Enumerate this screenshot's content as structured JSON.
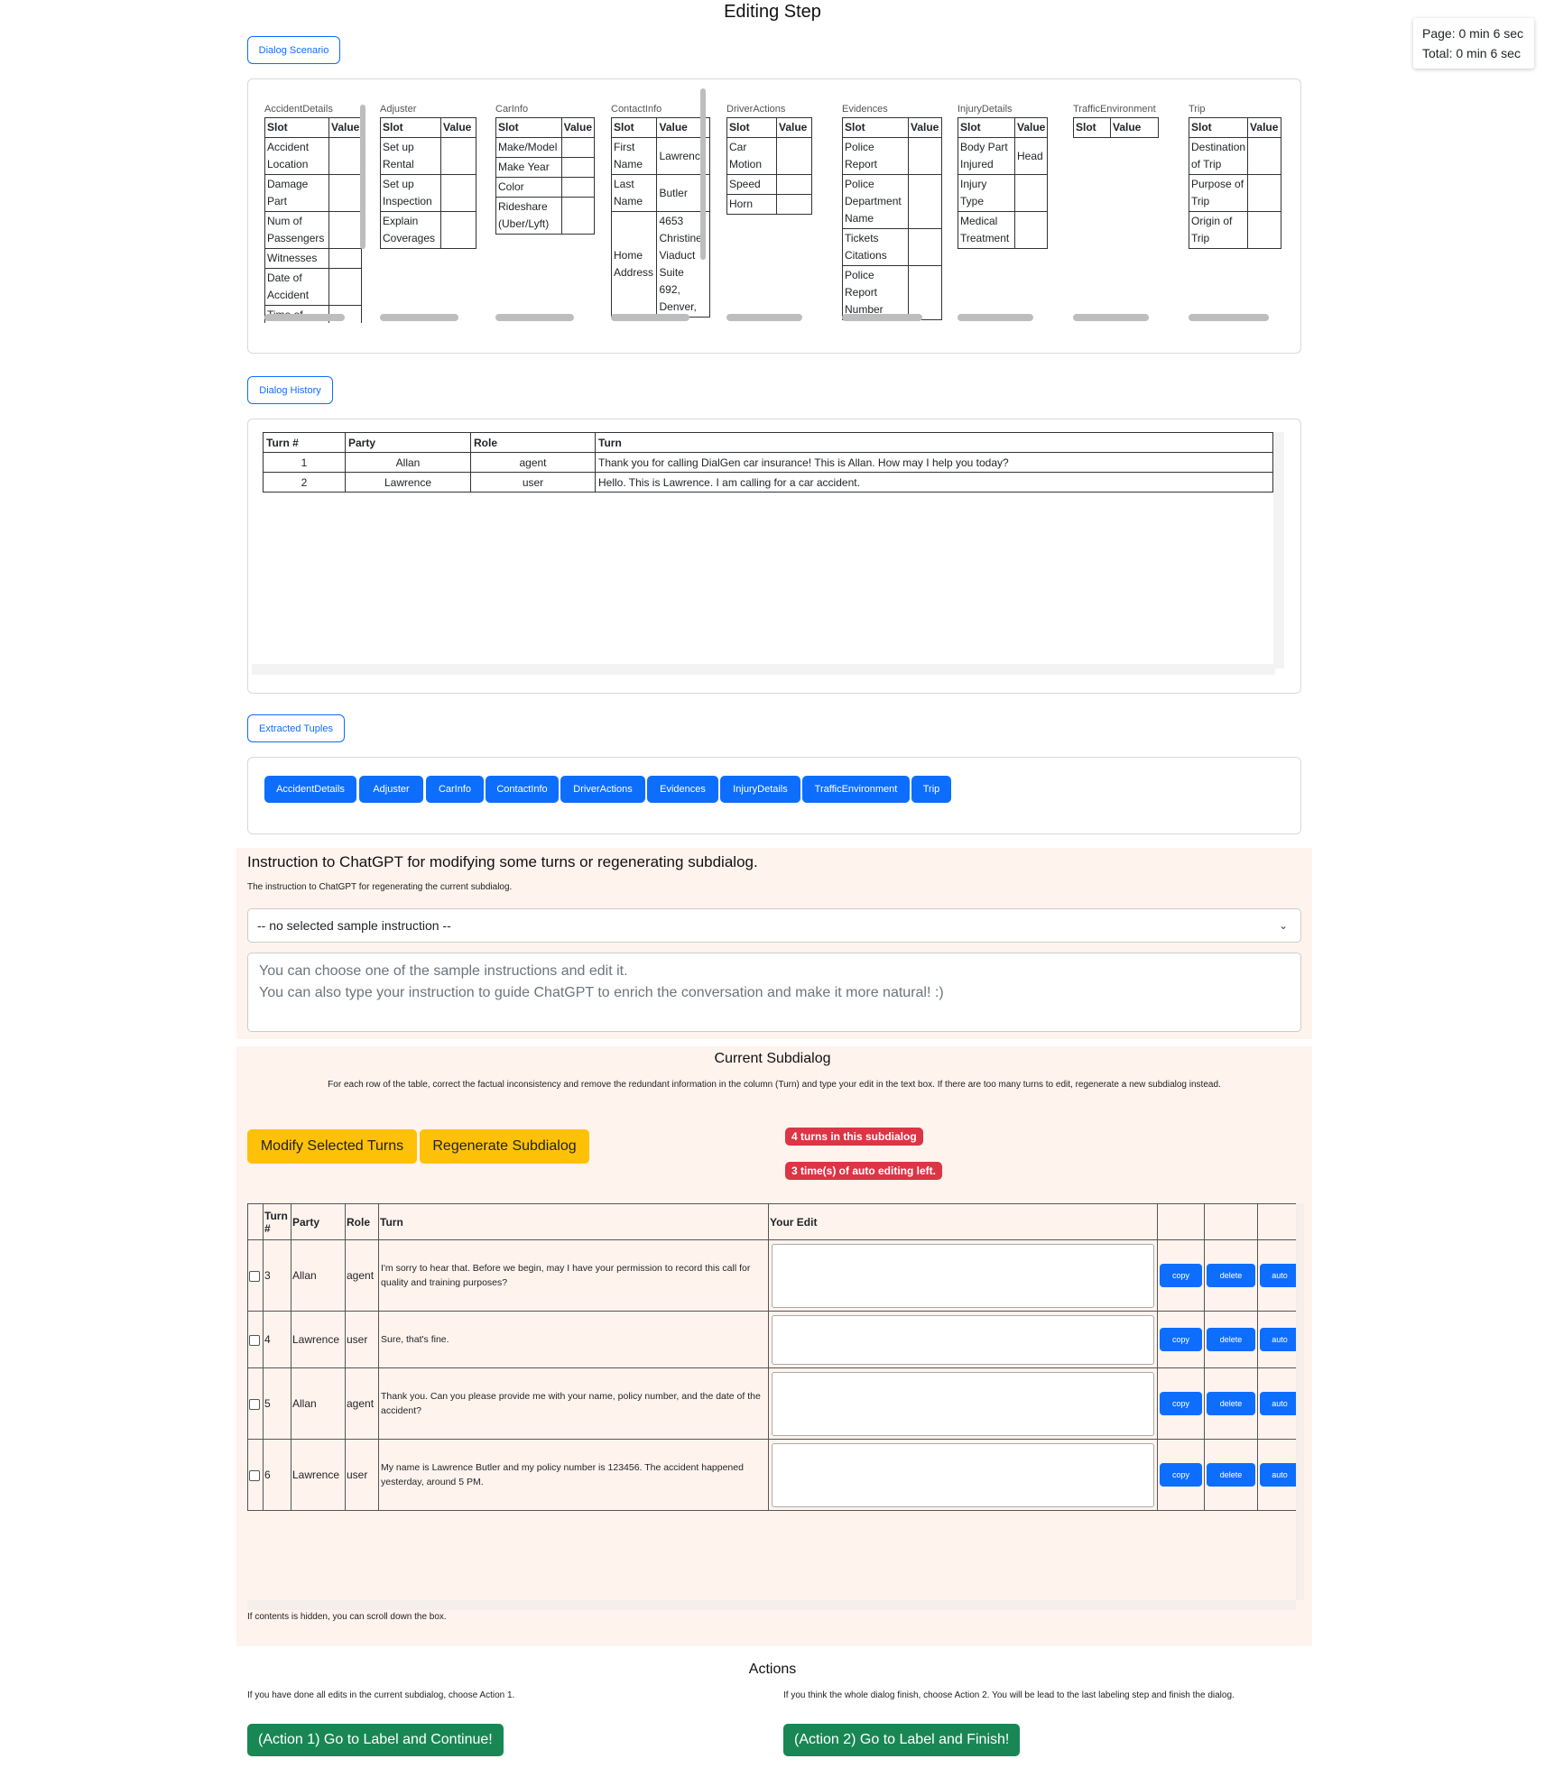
{
  "page_title": "Editing Step",
  "timer": {
    "page": "Page: 0 min 6 sec",
    "total": "Total: 0 min 6 sec"
  },
  "scenario": {
    "button": "Dialog Scenario",
    "slot_header": "Slot",
    "value_header": "Value",
    "categories": [
      {
        "name": "AccidentDetails",
        "rows": [
          {
            "slot": "Accident Location",
            "value": ""
          },
          {
            "slot": "Damage Part",
            "value": ""
          },
          {
            "slot": "Num of Passengers",
            "value": ""
          },
          {
            "slot": "Witnesses",
            "value": ""
          },
          {
            "slot": "Date of Accident",
            "value": ""
          },
          {
            "slot": "Time of",
            "value": ""
          }
        ]
      },
      {
        "name": "Adjuster",
        "rows": [
          {
            "slot": "Set up Rental",
            "value": ""
          },
          {
            "slot": "Set up Inspection",
            "value": ""
          },
          {
            "slot": "Explain Coverages",
            "value": ""
          }
        ]
      },
      {
        "name": "CarInfo",
        "rows": [
          {
            "slot": "Make/Model",
            "value": ""
          },
          {
            "slot": "Make Year",
            "value": ""
          },
          {
            "slot": "Color",
            "value": ""
          },
          {
            "slot": "Rideshare (Uber/Lyft)",
            "value": ""
          }
        ]
      },
      {
        "name": "ContactInfo",
        "rows": [
          {
            "slot": "First Name",
            "value": "Lawrence"
          },
          {
            "slot": "Last Name",
            "value": "Butler"
          },
          {
            "slot": "Home Address",
            "value": "4653 Christine Viaduct Suite 692, Denver,"
          }
        ]
      },
      {
        "name": "DriverActions",
        "rows": [
          {
            "slot": "Car Motion",
            "value": ""
          },
          {
            "slot": "Speed",
            "value": ""
          },
          {
            "slot": "Horn",
            "value": ""
          }
        ]
      },
      {
        "name": "Evidences",
        "rows": [
          {
            "slot": "Police Report",
            "value": ""
          },
          {
            "slot": "Police Department Name",
            "value": ""
          },
          {
            "slot": "Tickets Citations",
            "value": ""
          },
          {
            "slot": "Police Report Number",
            "value": ""
          }
        ]
      },
      {
        "name": "InjuryDetails",
        "rows": [
          {
            "slot": "Body Part Injured",
            "value": "Head"
          },
          {
            "slot": "Injury Type",
            "value": ""
          },
          {
            "slot": "Medical Treatment",
            "value": ""
          }
        ]
      },
      {
        "name": "TrafficEnvironment",
        "rows": []
      },
      {
        "name": "Trip",
        "rows": [
          {
            "slot": "Destination of Trip",
            "value": ""
          },
          {
            "slot": "Purpose of Trip",
            "value": ""
          },
          {
            "slot": "Origin of Trip",
            "value": ""
          }
        ]
      }
    ]
  },
  "history": {
    "button": "Dialog History",
    "headers": [
      "Turn #",
      "Party",
      "Role",
      "Turn"
    ],
    "rows": [
      {
        "turn": "1",
        "party": "Allan",
        "role": "agent",
        "text": "Thank you for calling DialGen car insurance! This is Allan. How may I help you today?"
      },
      {
        "turn": "2",
        "party": "Lawrence",
        "role": "user",
        "text": "Hello. This is Lawrence. I am calling for a car accident."
      }
    ]
  },
  "tuples": {
    "button": "Extracted Tuples",
    "tabs": [
      "AccidentDetails",
      "Adjuster",
      "CarInfo",
      "ContactInfo",
      "DriverActions",
      "Evidences",
      "InjuryDetails",
      "TrafficEnvironment",
      "Trip"
    ]
  },
  "instruction": {
    "heading": "Instruction to ChatGPT for modifying some turns or regenerating subdialog.",
    "sub": "The instruction to ChatGPT for regenerating the current subdialog.",
    "select_value": "-- no selected sample instruction --",
    "placeholder_line1": "You can choose one of the sample instructions and edit it.",
    "placeholder_line2": "You can also type your instruction to guide ChatGPT to enrich the conversation and make it more natural! :)"
  },
  "subdialog": {
    "heading": "Current Subdialog",
    "description": "For each row of the table, correct the factual inconsistency and remove the redundant information in the column (Turn) and type your edit in the text box. If there are too many turns to edit, regenerate a new subdialog instead.",
    "modify_button": "Modify Selected Turns",
    "regenerate_button": "Regenerate Subdialog",
    "badge_turns": "4 turns in this subdialog",
    "badge_auto": "3 time(s) of auto editing left.",
    "headers": {
      "turn": "Turn #",
      "party": "Party",
      "role": "Role",
      "text": "Turn",
      "edit": "Your Edit"
    },
    "row_buttons": {
      "copy": "copy",
      "delete": "delete",
      "auto": "auto"
    },
    "rows": [
      {
        "turn": "3",
        "party": "Allan",
        "role": "agent",
        "text": "I'm sorry to hear that. Before we begin, may I have your permission to record this call for quality and training purposes?"
      },
      {
        "turn": "4",
        "party": "Lawrence",
        "role": "user",
        "text": "Sure, that's fine."
      },
      {
        "turn": "5",
        "party": "Allan",
        "role": "agent",
        "text": "Thank you. Can you please provide me with your name, policy number, and the date of the accident?"
      },
      {
        "turn": "6",
        "party": "Lawrence",
        "role": "user",
        "text": "My name is Lawrence Butler and my policy number is 123456. The accident happened yesterday, around 5 PM."
      }
    ],
    "scroll_note": "If contents is hidden, you can scroll down the box."
  },
  "actions": {
    "heading": "Actions",
    "note1": "If you have done all edits in the current subdialog, choose Action 1.",
    "note2": "If you think the whole dialog finish, choose Action 2. You will be lead to the last labeling step and finish the dialog.",
    "button1": "(Action 1) Go to Label and Continue!",
    "button2": "(Action 2) Go to Label and Finish!"
  },
  "colors": {
    "primary": "#0d6efd",
    "warning": "#ffc107",
    "danger": "#dc3545",
    "success": "#198754",
    "peach": "#fff3ed"
  }
}
